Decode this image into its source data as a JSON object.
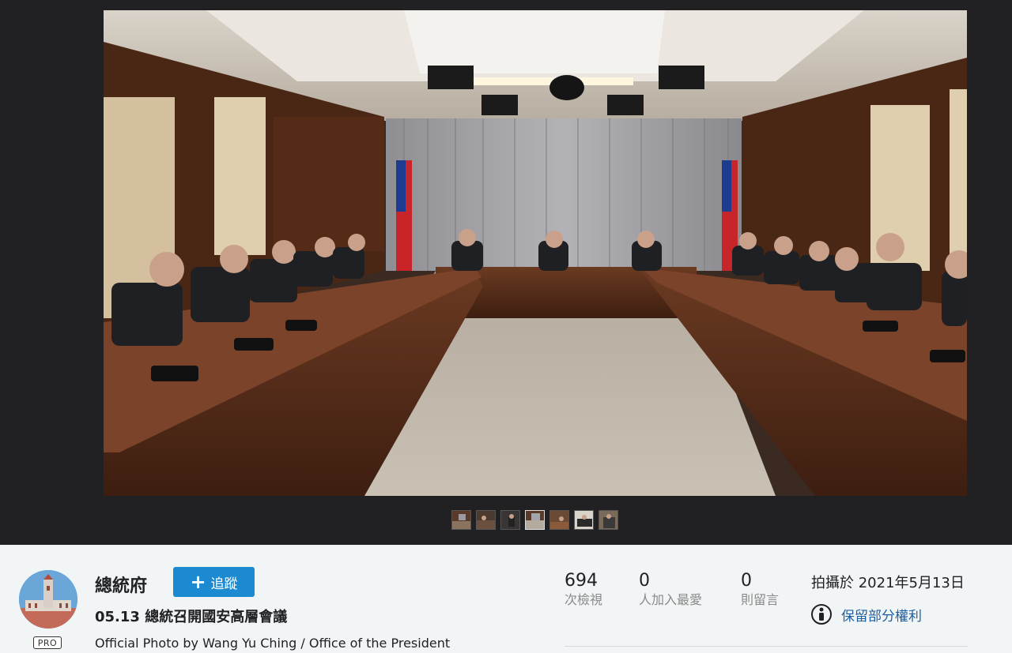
{
  "photo": {
    "alt": "05.13 總統召開國安高層會議"
  },
  "filmstrip": {
    "count": 7,
    "active_index": 3
  },
  "owner": {
    "name": "總統府",
    "badge": "PRO"
  },
  "follow_button": {
    "label": "追蹤"
  },
  "photo_info": {
    "title": "05.13 總統召開國安高層會議",
    "description": "Official Photo by Wang Yu Ching / Office of the President"
  },
  "stats": {
    "views": {
      "value": "694",
      "label": "次檢視"
    },
    "faves": {
      "value": "0",
      "label": "人加入最愛"
    },
    "comments": {
      "value": "0",
      "label": "則留言"
    }
  },
  "taken": {
    "text": "拍攝於 2021年5月13日"
  },
  "license": {
    "label": "保留部分權利",
    "icon": "person-info-icon"
  },
  "colors": {
    "follow_button": "#1c8ad1",
    "link": "#1c5fa0",
    "panel_bg": "#f2f5f6",
    "viewer_bg": "#212124"
  }
}
